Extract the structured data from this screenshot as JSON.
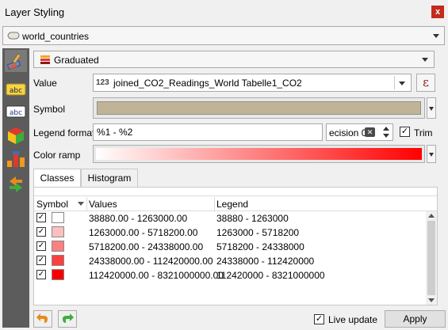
{
  "window": {
    "title": "Layer Styling",
    "close_glyph": "x"
  },
  "layer": {
    "name": "world_countries",
    "icon": "polygon-layer-icon"
  },
  "renderer": {
    "label": "Graduated",
    "icon": "graduated-renderer-icon"
  },
  "sidebar": {
    "items": [
      {
        "icon": "symbology-paintbrush-icon",
        "active": true
      },
      {
        "icon": "labels-abc-icon",
        "active": false
      },
      {
        "icon": "masks-abc-icon",
        "active": false
      },
      {
        "icon": "3d-view-cube-icon",
        "active": false
      },
      {
        "icon": "diagrams-icon",
        "active": false
      },
      {
        "icon": "history-icon",
        "active": false
      }
    ]
  },
  "form": {
    "value_label": "Value",
    "value_type_badge": "123",
    "value_field": "joined_CO2_Readings_World Tabelle1_CO2",
    "expression_glyph": "ε",
    "symbol_label": "Symbol",
    "symbol_color": "#c1b496",
    "legend_format_label": "Legend format",
    "legend_format_value": "%1 - %2",
    "precision_text": "ecision 0",
    "trim_label": "Trim",
    "trim_checked": true,
    "color_ramp_label": "Color ramp",
    "ramp_start": "#ffffff",
    "ramp_end": "#ff0000"
  },
  "tabs": [
    {
      "label": "Classes",
      "active": true
    },
    {
      "label": "Histogram",
      "active": false
    }
  ],
  "table": {
    "headers": [
      "Symbol",
      "Values",
      "Legend"
    ],
    "rows": [
      {
        "checked": true,
        "color": "#ffffff",
        "values": "38880.00 - 1263000.00",
        "legend": "38880 - 1263000"
      },
      {
        "checked": true,
        "color": "#fdbfbf",
        "values": "1263000.00 - 5718200.00",
        "legend": "1263000 - 5718200"
      },
      {
        "checked": true,
        "color": "#fc8080",
        "values": "5718200.00 - 24338000.00",
        "legend": "5718200 - 24338000"
      },
      {
        "checked": true,
        "color": "#fb4040",
        "values": "24338000.00 - 112420000.00",
        "legend": "24338000 - 112420000"
      },
      {
        "checked": true,
        "color": "#f90000",
        "values": "112420000.00 - 8321000000.00",
        "legend": "112420000 - 8321000000"
      }
    ]
  },
  "footer": {
    "undo_icon": "undo-arrow-icon",
    "redo_icon": "redo-arrow-icon",
    "live_update_label": "Live update",
    "live_update_checked": true,
    "apply_label": "Apply"
  }
}
